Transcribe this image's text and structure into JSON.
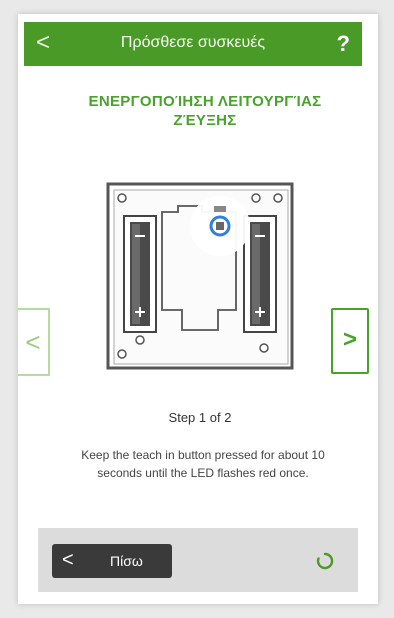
{
  "header": {
    "back_symbol": "<",
    "title": "Πρόσθεσε συσκευές",
    "help_symbol": "?"
  },
  "main": {
    "mode_title": "ΕΝΕΡΓΟΠΟΊΗΣΗ ΛΕΙΤΟΥΡΓΊΑΣ\nΖΈΥΞΗΣ",
    "prev_symbol": "<",
    "next_symbol": ">",
    "step_text": "Step 1 of 2",
    "instruction": "Keep the teach in button pressed for about 10 seconds until the LED flashes red once."
  },
  "footer": {
    "back_symbol": "<",
    "back_label": "Πίσω"
  },
  "colors": {
    "brand_green": "#4a9a28",
    "accent_green": "#48a22c",
    "highlight_blue": "#2f7fe0"
  },
  "icons": {
    "header_back": "chevron-left-icon",
    "help": "question-mark-icon",
    "prev": "chevron-left-icon",
    "next": "chevron-right-icon",
    "loading": "spinner-icon"
  }
}
